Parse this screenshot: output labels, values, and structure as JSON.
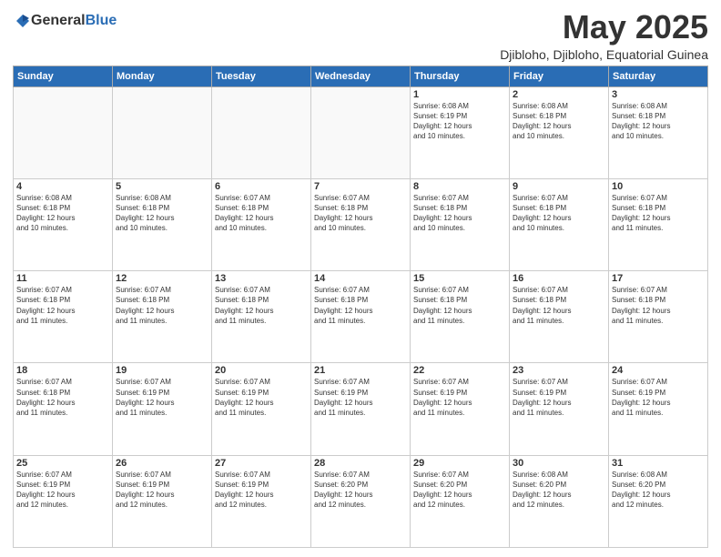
{
  "logo": {
    "general": "General",
    "blue": "Blue"
  },
  "header": {
    "month_year": "May 2025",
    "location": "Djibloho, Djibloho, Equatorial Guinea"
  },
  "days_of_week": [
    "Sunday",
    "Monday",
    "Tuesday",
    "Wednesday",
    "Thursday",
    "Friday",
    "Saturday"
  ],
  "weeks": [
    [
      {
        "day": "",
        "info": ""
      },
      {
        "day": "",
        "info": ""
      },
      {
        "day": "",
        "info": ""
      },
      {
        "day": "",
        "info": ""
      },
      {
        "day": "1",
        "info": "Sunrise: 6:08 AM\nSunset: 6:19 PM\nDaylight: 12 hours\nand 10 minutes."
      },
      {
        "day": "2",
        "info": "Sunrise: 6:08 AM\nSunset: 6:18 PM\nDaylight: 12 hours\nand 10 minutes."
      },
      {
        "day": "3",
        "info": "Sunrise: 6:08 AM\nSunset: 6:18 PM\nDaylight: 12 hours\nand 10 minutes."
      }
    ],
    [
      {
        "day": "4",
        "info": "Sunrise: 6:08 AM\nSunset: 6:18 PM\nDaylight: 12 hours\nand 10 minutes."
      },
      {
        "day": "5",
        "info": "Sunrise: 6:08 AM\nSunset: 6:18 PM\nDaylight: 12 hours\nand 10 minutes."
      },
      {
        "day": "6",
        "info": "Sunrise: 6:07 AM\nSunset: 6:18 PM\nDaylight: 12 hours\nand 10 minutes."
      },
      {
        "day": "7",
        "info": "Sunrise: 6:07 AM\nSunset: 6:18 PM\nDaylight: 12 hours\nand 10 minutes."
      },
      {
        "day": "8",
        "info": "Sunrise: 6:07 AM\nSunset: 6:18 PM\nDaylight: 12 hours\nand 10 minutes."
      },
      {
        "day": "9",
        "info": "Sunrise: 6:07 AM\nSunset: 6:18 PM\nDaylight: 12 hours\nand 10 minutes."
      },
      {
        "day": "10",
        "info": "Sunrise: 6:07 AM\nSunset: 6:18 PM\nDaylight: 12 hours\nand 11 minutes."
      }
    ],
    [
      {
        "day": "11",
        "info": "Sunrise: 6:07 AM\nSunset: 6:18 PM\nDaylight: 12 hours\nand 11 minutes."
      },
      {
        "day": "12",
        "info": "Sunrise: 6:07 AM\nSunset: 6:18 PM\nDaylight: 12 hours\nand 11 minutes."
      },
      {
        "day": "13",
        "info": "Sunrise: 6:07 AM\nSunset: 6:18 PM\nDaylight: 12 hours\nand 11 minutes."
      },
      {
        "day": "14",
        "info": "Sunrise: 6:07 AM\nSunset: 6:18 PM\nDaylight: 12 hours\nand 11 minutes."
      },
      {
        "day": "15",
        "info": "Sunrise: 6:07 AM\nSunset: 6:18 PM\nDaylight: 12 hours\nand 11 minutes."
      },
      {
        "day": "16",
        "info": "Sunrise: 6:07 AM\nSunset: 6:18 PM\nDaylight: 12 hours\nand 11 minutes."
      },
      {
        "day": "17",
        "info": "Sunrise: 6:07 AM\nSunset: 6:18 PM\nDaylight: 12 hours\nand 11 minutes."
      }
    ],
    [
      {
        "day": "18",
        "info": "Sunrise: 6:07 AM\nSunset: 6:18 PM\nDaylight: 12 hours\nand 11 minutes."
      },
      {
        "day": "19",
        "info": "Sunrise: 6:07 AM\nSunset: 6:19 PM\nDaylight: 12 hours\nand 11 minutes."
      },
      {
        "day": "20",
        "info": "Sunrise: 6:07 AM\nSunset: 6:19 PM\nDaylight: 12 hours\nand 11 minutes."
      },
      {
        "day": "21",
        "info": "Sunrise: 6:07 AM\nSunset: 6:19 PM\nDaylight: 12 hours\nand 11 minutes."
      },
      {
        "day": "22",
        "info": "Sunrise: 6:07 AM\nSunset: 6:19 PM\nDaylight: 12 hours\nand 11 minutes."
      },
      {
        "day": "23",
        "info": "Sunrise: 6:07 AM\nSunset: 6:19 PM\nDaylight: 12 hours\nand 11 minutes."
      },
      {
        "day": "24",
        "info": "Sunrise: 6:07 AM\nSunset: 6:19 PM\nDaylight: 12 hours\nand 11 minutes."
      }
    ],
    [
      {
        "day": "25",
        "info": "Sunrise: 6:07 AM\nSunset: 6:19 PM\nDaylight: 12 hours\nand 12 minutes."
      },
      {
        "day": "26",
        "info": "Sunrise: 6:07 AM\nSunset: 6:19 PM\nDaylight: 12 hours\nand 12 minutes."
      },
      {
        "day": "27",
        "info": "Sunrise: 6:07 AM\nSunset: 6:19 PM\nDaylight: 12 hours\nand 12 minutes."
      },
      {
        "day": "28",
        "info": "Sunrise: 6:07 AM\nSunset: 6:20 PM\nDaylight: 12 hours\nand 12 minutes."
      },
      {
        "day": "29",
        "info": "Sunrise: 6:07 AM\nSunset: 6:20 PM\nDaylight: 12 hours\nand 12 minutes."
      },
      {
        "day": "30",
        "info": "Sunrise: 6:08 AM\nSunset: 6:20 PM\nDaylight: 12 hours\nand 12 minutes."
      },
      {
        "day": "31",
        "info": "Sunrise: 6:08 AM\nSunset: 6:20 PM\nDaylight: 12 hours\nand 12 minutes."
      }
    ]
  ]
}
